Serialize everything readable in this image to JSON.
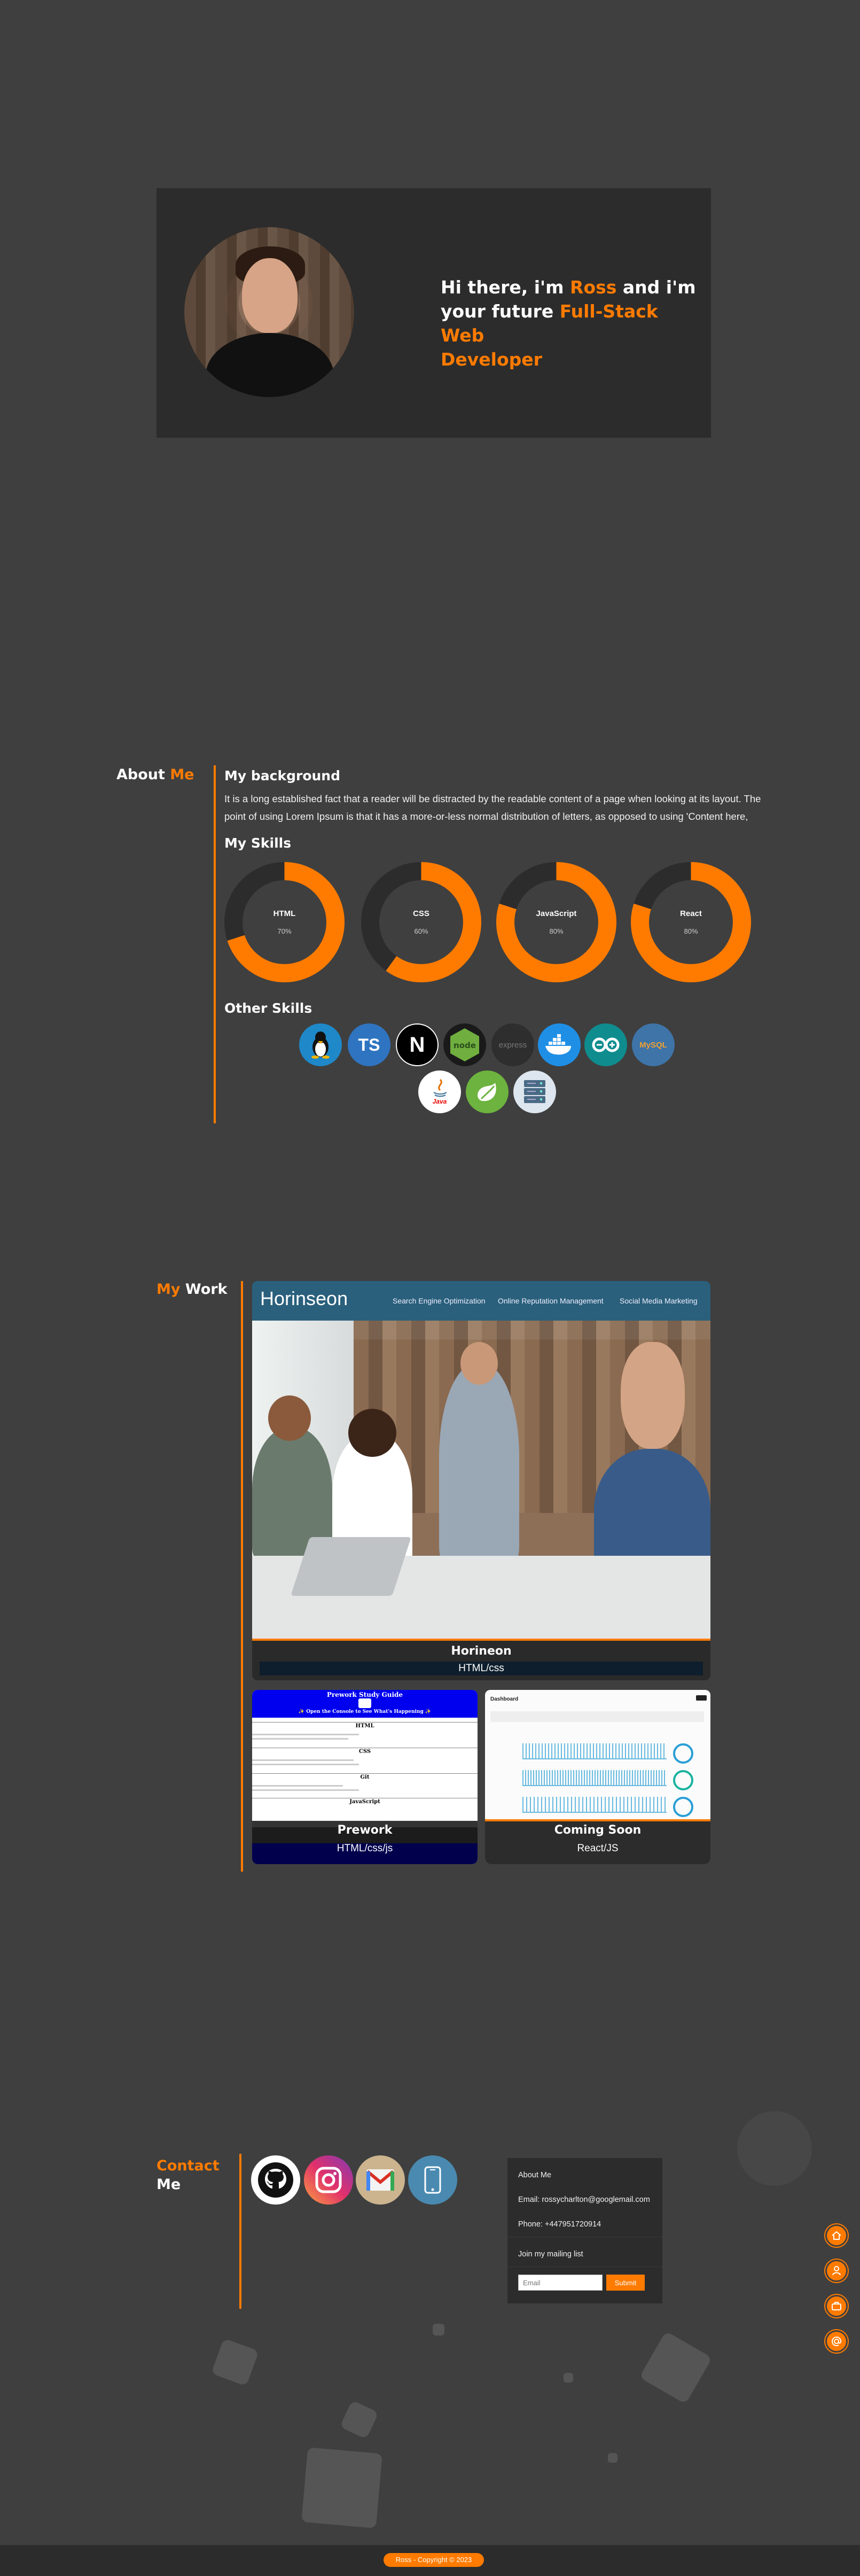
{
  "hero": {
    "line1_a": "Hi there, i'm ",
    "line1_name": "Ross",
    "line1_b": " and i'm",
    "line2_a": "your future ",
    "line2_role": "Full-Stack Web",
    "line3_role": "Developer"
  },
  "about": {
    "title_a": "About ",
    "title_b": "Me",
    "background_title": "My background",
    "background_text": "It is a long established fact that a reader will be distracted by the readable content of a page when looking at its layout. The point of using Lorem Ipsum is that it has a more-or-less normal distribution of letters, as opposed to using 'Content here,",
    "skills_title": "My Skills",
    "skills": [
      {
        "label": "HTML",
        "percent": 70,
        "display": "70%"
      },
      {
        "label": "CSS",
        "percent": 60,
        "display": "60%"
      },
      {
        "label": "JavaScript",
        "percent": 80,
        "display": "80%"
      },
      {
        "label": "React",
        "percent": 80,
        "display": "80%"
      }
    ],
    "other_skills_title": "Other Skills",
    "other_skills": {
      "linux": "",
      "typescript": "TS",
      "nextjs": "N",
      "nodejs": "node",
      "express": "express",
      "docker": "",
      "arduino": "",
      "mysql": "MySQL",
      "java": "Java",
      "spring": "",
      "server": ""
    }
  },
  "work": {
    "title_a": "My ",
    "title_b": "Work",
    "main_project": {
      "site_logo": "Horinseon",
      "nav": [
        "Search Engine Optimization",
        "Online Reputation Management",
        "Social Media Marketing"
      ],
      "name": "Horineon",
      "tech": "HTML/css"
    },
    "projects": [
      {
        "name": "Prework",
        "tech": "HTML/css/js",
        "preview_title": "Prework Study Guide",
        "preview_sub": "✨ Open the Console to See What's Happening ✨",
        "preview_sections": [
          "HTML",
          "CSS",
          "Git",
          "JavaScript"
        ]
      },
      {
        "name": "Coming Soon",
        "tech": "React/JS",
        "preview_title": "Dashboard"
      }
    ]
  },
  "contact": {
    "title_a": "Contact",
    "title_b": "Me",
    "info": {
      "heading": "About Me",
      "email": "Email: rossycharlton@googlemail.com",
      "phone": "Phone: +447951720914",
      "mailing": "Join my mailing list",
      "placeholder": "Email",
      "submit": "Submit"
    }
  },
  "footer": {
    "text": "Ross - Copyright © 2023"
  },
  "colors": {
    "accent": "#ff7b00",
    "background": "#3f3f3f",
    "panel": "#2c2c2c"
  }
}
